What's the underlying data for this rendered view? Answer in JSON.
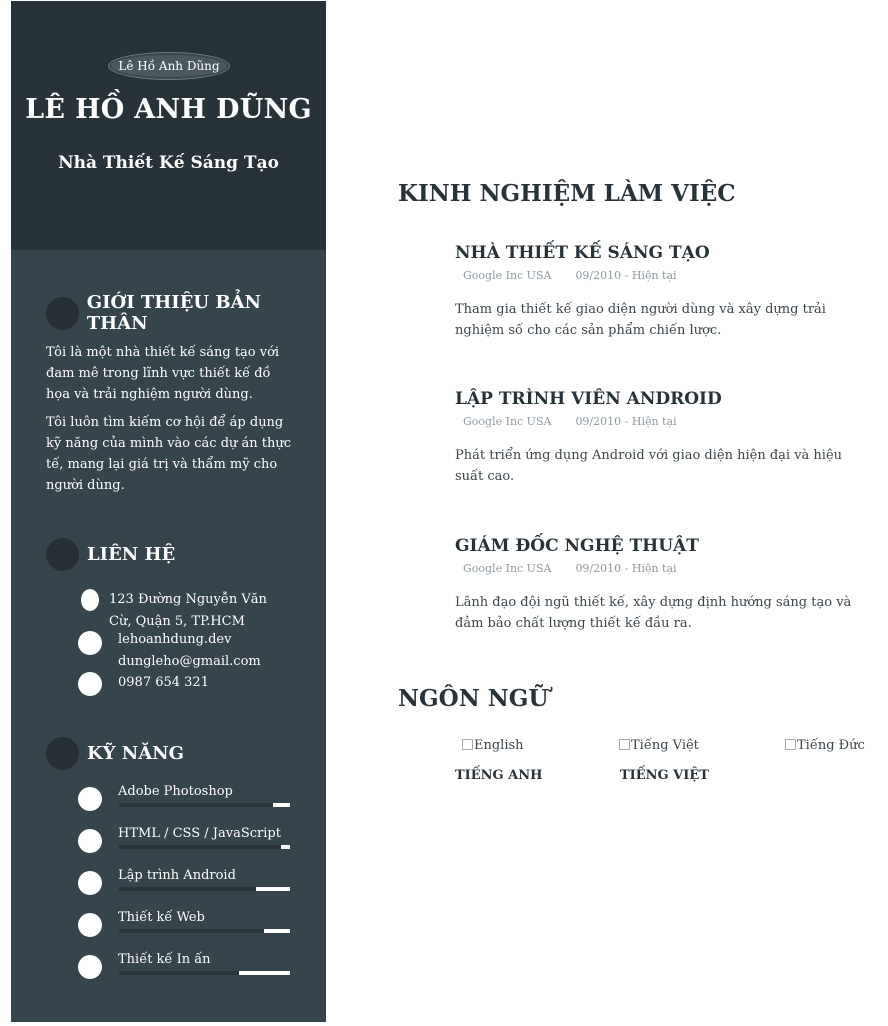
{
  "profile": {
    "avatar_alt": "Lê Hồ Anh Dũng",
    "name": "LÊ HỒ ANH DŨNG",
    "role": "Nhà Thiết Kế Sáng Tạo"
  },
  "about": {
    "title": "GIỚI THIỆU BẢN THÂN",
    "paragraphs": [
      "Tôi là một nhà thiết kế sáng tạo với đam mê trong lĩnh vực thiết kế đồ họa và trải nghiệm người dùng.",
      "Tôi luôn tìm kiếm cơ hội để áp dụng kỹ năng của mình vào các dự án thực tế, mang lại giá trị và thẩm mỹ cho người dùng."
    ]
  },
  "contact": {
    "title": "LIÊN HỆ",
    "address": "123 Đường Nguyễn Văn Cừ, Quận 5, TP.HCM",
    "website": "lehoanhdung.dev",
    "email": "dungleho@gmail.com",
    "phone": "0987 654 321"
  },
  "skills": {
    "title": "KỸ NĂNG",
    "items": [
      {
        "label": "Adobe Photoshop",
        "level": 0.9
      },
      {
        "label": "HTML / CSS / JavaScript",
        "level": 0.95
      },
      {
        "label": "Lập trình Android",
        "level": 0.8
      },
      {
        "label": "Thiết kế Web",
        "level": 0.85
      },
      {
        "label": "Thiết kế In ấn",
        "level": 0.7
      }
    ]
  },
  "experience": {
    "title": "KINH NGHIỆM LÀM VIỆC",
    "jobs": [
      {
        "title": "NHÀ THIẾT KẾ SÁNG TẠO",
        "company": "Google Inc USA",
        "period": "09/2010 - Hiện tại",
        "description": "Tham gia thiết kế giao diện người dùng và xây dựng trải nghiệm số cho các sản phẩm chiến lược."
      },
      {
        "title": "LẬP TRÌNH VIÊN ANDROID",
        "company": "Google Inc USA",
        "period": "09/2010 - Hiện tại",
        "description": "Phát triển ứng dụng Android với giao diện hiện đại và hiệu suất cao."
      },
      {
        "title": "GIÁM ĐỐC NGHỆ THUẬT",
        "company": "Google Inc USA",
        "period": "09/2010 - Hiện tại",
        "description": "Lãnh đạo đội ngũ thiết kế, xây dựng định hướng sáng tạo và đảm bảo chất lượng thiết kế đầu ra."
      }
    ]
  },
  "languages": {
    "title": "NGÔN NGỮ",
    "items": [
      {
        "img_alt": "English",
        "label": "TIẾNG ANH"
      },
      {
        "img_alt": "Tiếng Việt",
        "label": "TIẾNG VIỆT"
      },
      {
        "img_alt": "Tiếng Đức",
        "label": ""
      }
    ]
  }
}
